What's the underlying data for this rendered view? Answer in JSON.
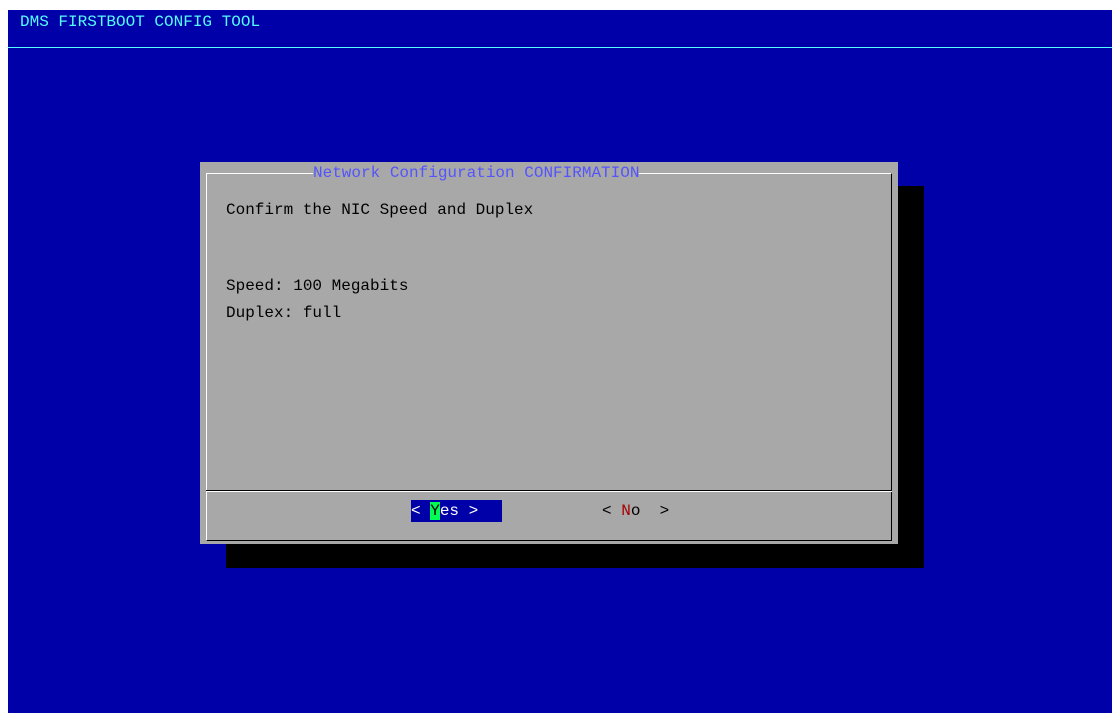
{
  "backtitle": "DMS FIRSTBOOT CONFIG TOOL",
  "dialog": {
    "title": "Network Configuration CONFIRMATION",
    "message_line": "Confirm the NIC Speed and Duplex",
    "speed_line": "Speed: 100 Megabits",
    "duplex_line": "Duplex: full"
  },
  "buttons": {
    "yes": {
      "left_bracket": "< ",
      "hotkey": "Y",
      "rest": "es >",
      "selected": true
    },
    "no": {
      "left_bracket": "< ",
      "hotkey": "N",
      "rest": "o  >",
      "selected": false
    }
  },
  "colors": {
    "background": "#0000a8",
    "backtitle": "#54fcfc",
    "dialog_bg": "#a8a8a8",
    "dialog_title": "#5454fc",
    "selected_button_bg": "#0000a8",
    "hotkey_selected_bg": "#00fc54",
    "hotkey_unselected": "#a80000",
    "shadow": "#000000"
  }
}
